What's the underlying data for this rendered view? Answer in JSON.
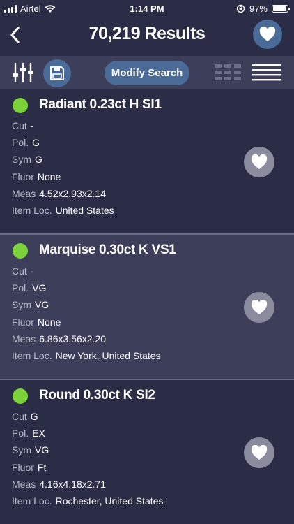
{
  "status_bar": {
    "carrier": "Airtel",
    "time": "1:14 PM",
    "battery": "97%",
    "battery_level": 0.97
  },
  "header": {
    "title": "70,219 Results"
  },
  "toolbar": {
    "modify_label": "Modify Search"
  },
  "labels": {
    "cut": "Cut",
    "pol": "Pol.",
    "sym": "Sym",
    "fluor": "Fluor",
    "meas": "Meas",
    "loc": "Item Loc."
  },
  "items": [
    {
      "name": "Radiant 0.23ct H SI1",
      "cut": "-",
      "pol": "G",
      "sym": "G",
      "fluor": "None",
      "meas": "4.52x2.93x2.14",
      "loc": "United States"
    },
    {
      "name": "Marquise 0.30ct K VS1",
      "cut": "-",
      "pol": "VG",
      "sym": "VG",
      "fluor": "None",
      "meas": "6.86x3.56x2.20",
      "loc": "New York, United States"
    },
    {
      "name": "Round 0.30ct K SI2",
      "cut": "G",
      "pol": "EX",
      "sym": "VG",
      "fluor": "Ft",
      "meas": "4.16x4.18x2.71",
      "loc": "Rochester, United States"
    }
  ],
  "colors": {
    "background": "#2b2c45",
    "alt_row": "#3d3e5a",
    "accent": "#4a6a98",
    "status_dot": "#7bd23a"
  }
}
